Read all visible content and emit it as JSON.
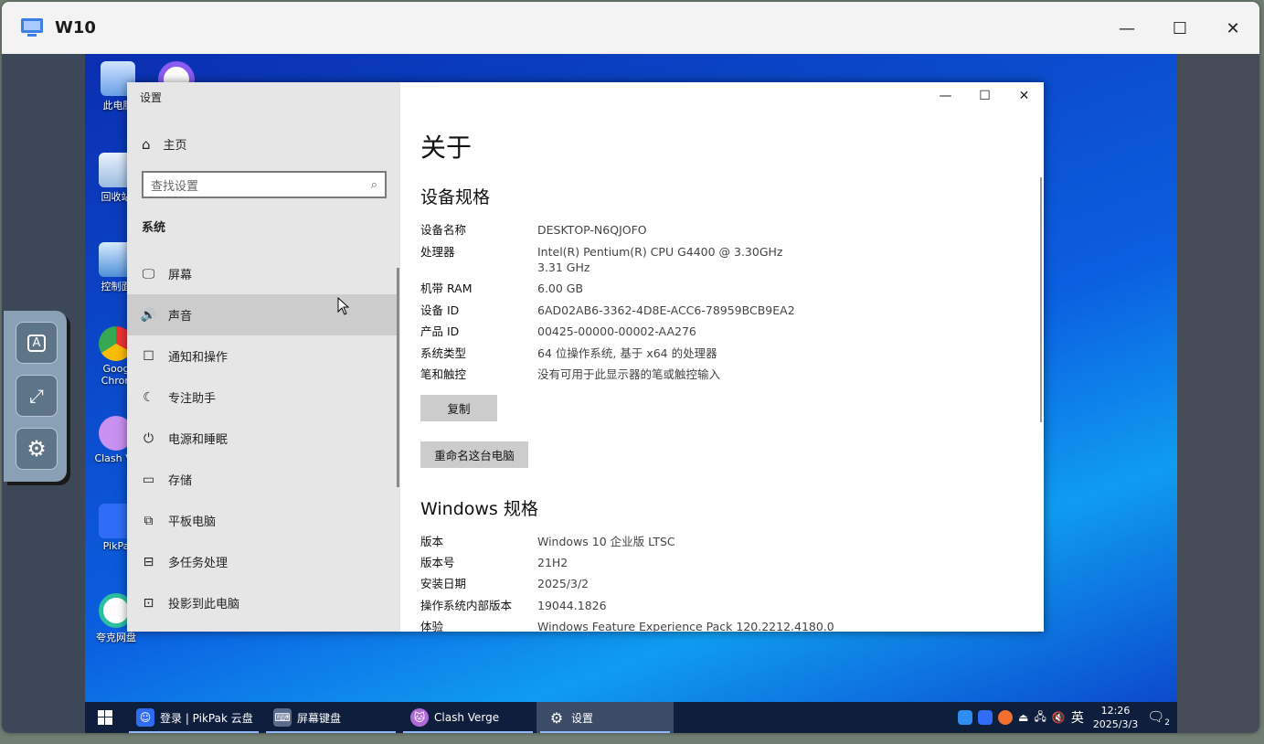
{
  "host": {
    "title": "W10",
    "minimize": "—",
    "maximize": "☐",
    "close": "✕"
  },
  "desktop": {
    "icons": [
      {
        "label": "此电脑"
      },
      {
        "label": "回收站"
      },
      {
        "label": "控制面"
      },
      {
        "label": "Goog Chron"
      },
      {
        "label": "Clash Ve"
      },
      {
        "label": "PikPa"
      },
      {
        "label": "夸克网盘"
      }
    ]
  },
  "settings": {
    "app_title": "设置",
    "home": "主页",
    "search_placeholder": "查找设置",
    "section": "系统",
    "nav": [
      {
        "label": "屏幕",
        "icon": "🖵"
      },
      {
        "label": "声音",
        "icon": "🔊"
      },
      {
        "label": "通知和操作",
        "icon": "☐"
      },
      {
        "label": "专注助手",
        "icon": "☾"
      },
      {
        "label": "电源和睡眠",
        "icon": "⏻"
      },
      {
        "label": "存储",
        "icon": "▭"
      },
      {
        "label": "平板电脑",
        "icon": "⧉"
      },
      {
        "label": "多任务处理",
        "icon": "⊟"
      },
      {
        "label": "投影到此电脑",
        "icon": "⊡"
      }
    ],
    "selected_nav": "声音",
    "page_title": "关于",
    "device_spec_heading": "设备规格",
    "device_specs": [
      {
        "k": "设备名称",
        "v": "DESKTOP-N6QJOFO"
      },
      {
        "k": "处理器",
        "v": "Intel(R) Pentium(R) CPU G4400 @ 3.30GHz   3.31 GHz"
      },
      {
        "k": "机带 RAM",
        "v": "6.00 GB"
      },
      {
        "k": "设备 ID",
        "v": "6AD02AB6-3362-4D8E-ACC6-78959BCB9EA2"
      },
      {
        "k": "产品 ID",
        "v": "00425-00000-00002-AA276"
      },
      {
        "k": "系统类型",
        "v": "64 位操作系统, 基于 x64 的处理器"
      },
      {
        "k": "笔和触控",
        "v": "没有可用于此显示器的笔或触控输入"
      }
    ],
    "copy_button": "复制",
    "rename_button": "重命名这台电脑",
    "windows_spec_heading": "Windows 规格",
    "windows_specs": [
      {
        "k": "版本",
        "v": "Windows 10 企业版 LTSC"
      },
      {
        "k": "版本号",
        "v": "21H2"
      },
      {
        "k": "安装日期",
        "v": "2025/3/2"
      },
      {
        "k": "操作系统内部版本",
        "v": "19044.1826"
      },
      {
        "k": "体验",
        "v": "Windows Feature Experience Pack 120.2212.4180.0"
      }
    ]
  },
  "taskbar": {
    "items": [
      {
        "label": "登录 | PikPak 云盘",
        "color": "#2f6df6"
      },
      {
        "label": "屏幕键盘",
        "color": "#5a6b8c"
      },
      {
        "label": "Clash Verge",
        "color": "#b06ad8"
      },
      {
        "label": "设置",
        "color": "#3c4c66"
      }
    ],
    "ime": "英",
    "time": "12:26",
    "date": "2025/3/3",
    "notification_count": "2"
  }
}
